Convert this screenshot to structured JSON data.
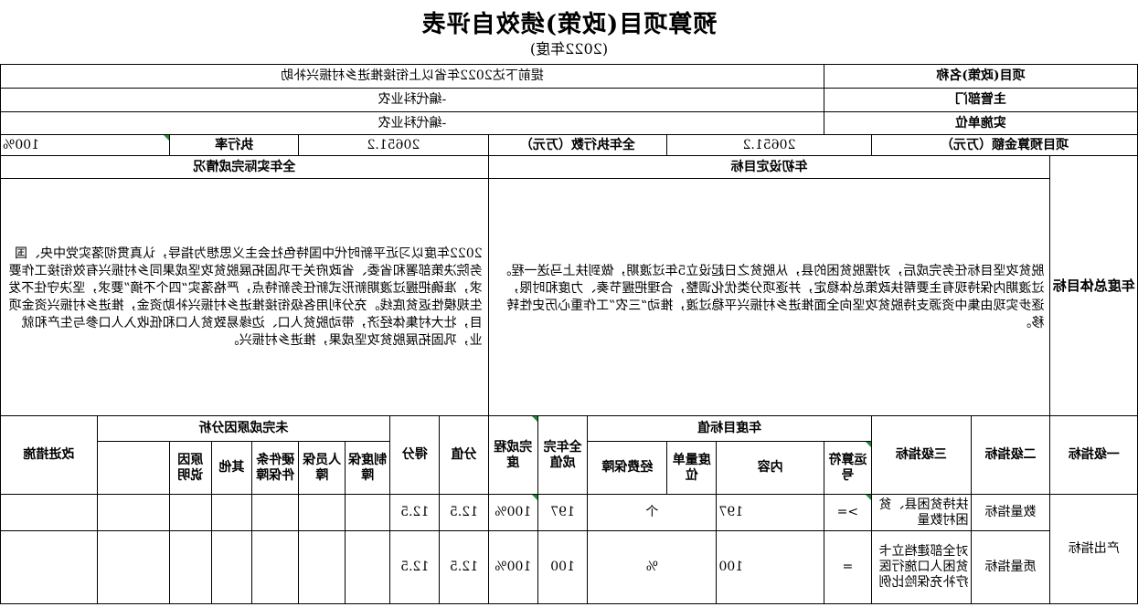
{
  "header": {
    "title": "预算项目(政策)绩效自评表",
    "year": "(2022年度)"
  },
  "project": {
    "name_label": "项目(政策)名称",
    "name_value": "提前下达2022年省以上衔接推进乡村振兴补助",
    "dept_label": "主管部门",
    "dept_value": "-编代科业农",
    "unit_label": "实施单位",
    "unit_value": "-编代科业农",
    "budget_label": "项目预算金额（万元）",
    "budget_value": "20651.2",
    "exec_label": "全年执行数（万元）",
    "exec_value": "20651.2",
    "rate_label": "执行率",
    "rate_value": "100%"
  },
  "goals": {
    "overall_label": "年度总体目标",
    "planned_header": "年初设定目标",
    "actual_header": "全年实际完成情况",
    "planned_text": "脱贫攻坚目标任务完成后，对摆脱贫困的县，从脱贫之日起设立5年过渡期，做到扶上马送一程。过渡期内保持现有主要帮扶政策总体稳定，并逐项分类优化调整，合理把握节奏、力度和时限，逐步实现由集中资源支持脱贫攻坚向全面推进乡村振兴平稳过渡，推动“三农”工作重心历史性转移。",
    "actual_text": "2022年度以习近平新时代中国特色社会主义思想为指导，认真贯彻落实党中央、国务院决策部署和省委、省政府关于巩固拓展脱贫攻坚成果同乡村振兴有效衔接工作要求，准确把握过渡期新形式新任务新特点，严格落实“四个不摘”要求，坚决守住不发生规模性返贫底线。充分利用各级衔接推进乡村振兴补助资金，推进乡村振兴资金项目，壮大村集体经济，带动脱贫人口、边缘易致贫人口和低收入人口参与生产和就业，巩固拓展脱贫攻坚成果，推进乡村振兴。"
  },
  "indicators": {
    "headers": {
      "level1": "一级指标",
      "level2": "二级指标",
      "level3": "三级指标",
      "annual_target": "年度目标值",
      "operator": "运算符号",
      "content": "内容",
      "unit": "度量单位",
      "annual_done": "全年完成值",
      "completion": "完成程度",
      "score_value": "分值",
      "score": "得分",
      "reason_analysis": "未完成原因分析",
      "funding": "经费保障",
      "system": "制度保障",
      "personnel": "人员保障",
      "hardware": "硬件条件保障",
      "other": "其他",
      "reason_desc": "原因说明",
      "improve": "改进措施"
    },
    "rows": [
      {
        "level1": "产出指标",
        "level2": "数量指标",
        "level3": "扶持贫困县、贫困村数量",
        "operator": ">=",
        "content": "197",
        "unit": "个",
        "done": "197",
        "completion": "100%",
        "score_value": "12.5",
        "score": "12.5"
      },
      {
        "level2": "质量指标",
        "level3": "对全部建档立卡贫困人口施行医疗补充保险比例",
        "operator": "=",
        "content": "100",
        "unit": "%",
        "done": "100",
        "completion": "100%",
        "score_value": "12.5",
        "score": "12.5"
      }
    ]
  }
}
